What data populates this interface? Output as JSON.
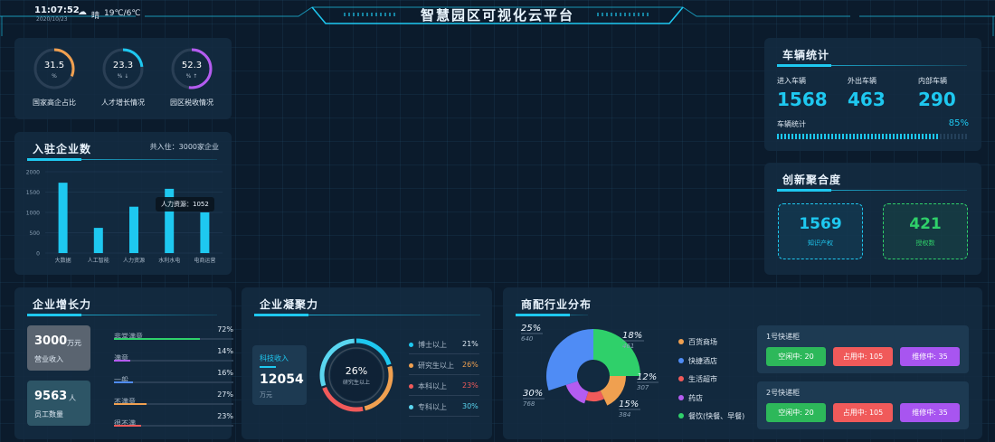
{
  "header": {
    "time": "11:07:52",
    "date": "2020/10/23",
    "weather": "晴",
    "temperature": "19℃/6℃",
    "title": "智慧园区可视化云平台"
  },
  "rings": [
    {
      "value": "31.5",
      "sub": "%",
      "label": "国家高企占比",
      "color": "#f0a050",
      "fraction": 0.315
    },
    {
      "value": "23.3",
      "sub": "% ↓",
      "label": "人才增长情况",
      "color": "#1ec8f0",
      "fraction": 0.233
    },
    {
      "value": "52.3",
      "sub": "% ↑",
      "label": "园区税收情况",
      "color": "#b45cf0",
      "fraction": 0.523
    }
  ],
  "enterprise_count": {
    "title": "入驻企业数",
    "summary": "共入住：3000家企业",
    "tooltip": "人力资源：1052"
  },
  "chart_data": {
    "type": "bar",
    "categories": [
      "大数据",
      "人工智能",
      "人力资源",
      "水利水电",
      "电商运营"
    ],
    "values": [
      1730,
      620,
      1140,
      1580,
      1000
    ],
    "ylim": [
      0,
      2000
    ],
    "yticks": [
      "2000",
      "1500",
      "1000",
      "500",
      "0"
    ],
    "color": "#1ec8f0"
  },
  "growth": {
    "title": "企业增长力",
    "revenue_value": "3000",
    "revenue_unit": "万元",
    "revenue_label": "营业收入",
    "staff_value": "9563",
    "staff_unit": "人",
    "staff_label": "员工数量",
    "rows": [
      {
        "label": "非常满意",
        "pct": "72%",
        "fraction": 0.72,
        "color": "#2fd06a"
      },
      {
        "label": "满意",
        "pct": "14%",
        "fraction": 0.14,
        "color": "#b45cf0"
      },
      {
        "label": "一般",
        "pct": "16%",
        "fraction": 0.16,
        "color": "#4f8cf5"
      },
      {
        "label": "不满意",
        "pct": "27%",
        "fraction": 0.27,
        "color": "#f0a050"
      },
      {
        "label": "很不满",
        "pct": "23%",
        "fraction": 0.23,
        "color": "#f05a5a"
      }
    ]
  },
  "cohesion": {
    "title": "企业凝聚力",
    "income_label": "科技收入",
    "income_value": "12054",
    "income_unit": "万元",
    "ring_value": "26%",
    "ring_label": "研究生以上",
    "legend": [
      {
        "label": "博士以上",
        "pct": "21%",
        "color": "#1ec8f0",
        "fraction": 0.21
      },
      {
        "label": "研究生以上",
        "pct": "26%",
        "color": "#f0a050",
        "fraction": 0.26
      },
      {
        "label": "本科以上",
        "pct": "23%",
        "color": "#f05a5a",
        "fraction": 0.23
      },
      {
        "label": "专科以上",
        "pct": "30%",
        "color": "#5ad6f0",
        "fraction": 0.3
      }
    ]
  },
  "industry": {
    "title": "商配行业分布",
    "slices": [
      {
        "pct": "25%",
        "value": "640",
        "color": "#2fd06a",
        "fraction": 0.25
      },
      {
        "pct": "18%",
        "value": "461",
        "color": "#f0a050",
        "fraction": 0.18
      },
      {
        "pct": "12%",
        "value": "307",
        "color": "#f05a5a",
        "fraction": 0.12
      },
      {
        "pct": "15%",
        "value": "384",
        "color": "#b45cf0",
        "fraction": 0.15
      },
      {
        "pct": "30%",
        "value": "768",
        "color": "#4f8cf5",
        "fraction": 0.3
      }
    ],
    "legend": [
      {
        "label": "百货商场",
        "color": "#f0a050"
      },
      {
        "label": "快捷酒店",
        "color": "#4f8cf5"
      },
      {
        "label": "生活超市",
        "color": "#f05a5a"
      },
      {
        "label": "药店",
        "color": "#b45cf0"
      },
      {
        "label": "餐饮(快餐、早餐)",
        "color": "#2fd06a"
      }
    ],
    "lockers": [
      {
        "name": "1号快递柜",
        "free": "空闲中: 20",
        "used": "占用中: 105",
        "repair": "维修中: 35"
      },
      {
        "name": "2号快递柜",
        "free": "空闲中: 20",
        "used": "占用中: 105",
        "repair": "维修中: 35"
      }
    ]
  },
  "vehicles": {
    "title": "车辆统计",
    "in_label": "进入车辆",
    "in_value": "1568",
    "out_label": "外出车辆",
    "out_value": "463",
    "inner_label": "内部车辆",
    "inner_value": "290",
    "stat_label": "车辆统计",
    "stat_pct": "85%",
    "stat_fraction": 0.85
  },
  "innovation": {
    "title": "创新聚合度",
    "ip_value": "1569",
    "ip_label": "知识产权",
    "auth_value": "421",
    "auth_label": "授权数"
  }
}
